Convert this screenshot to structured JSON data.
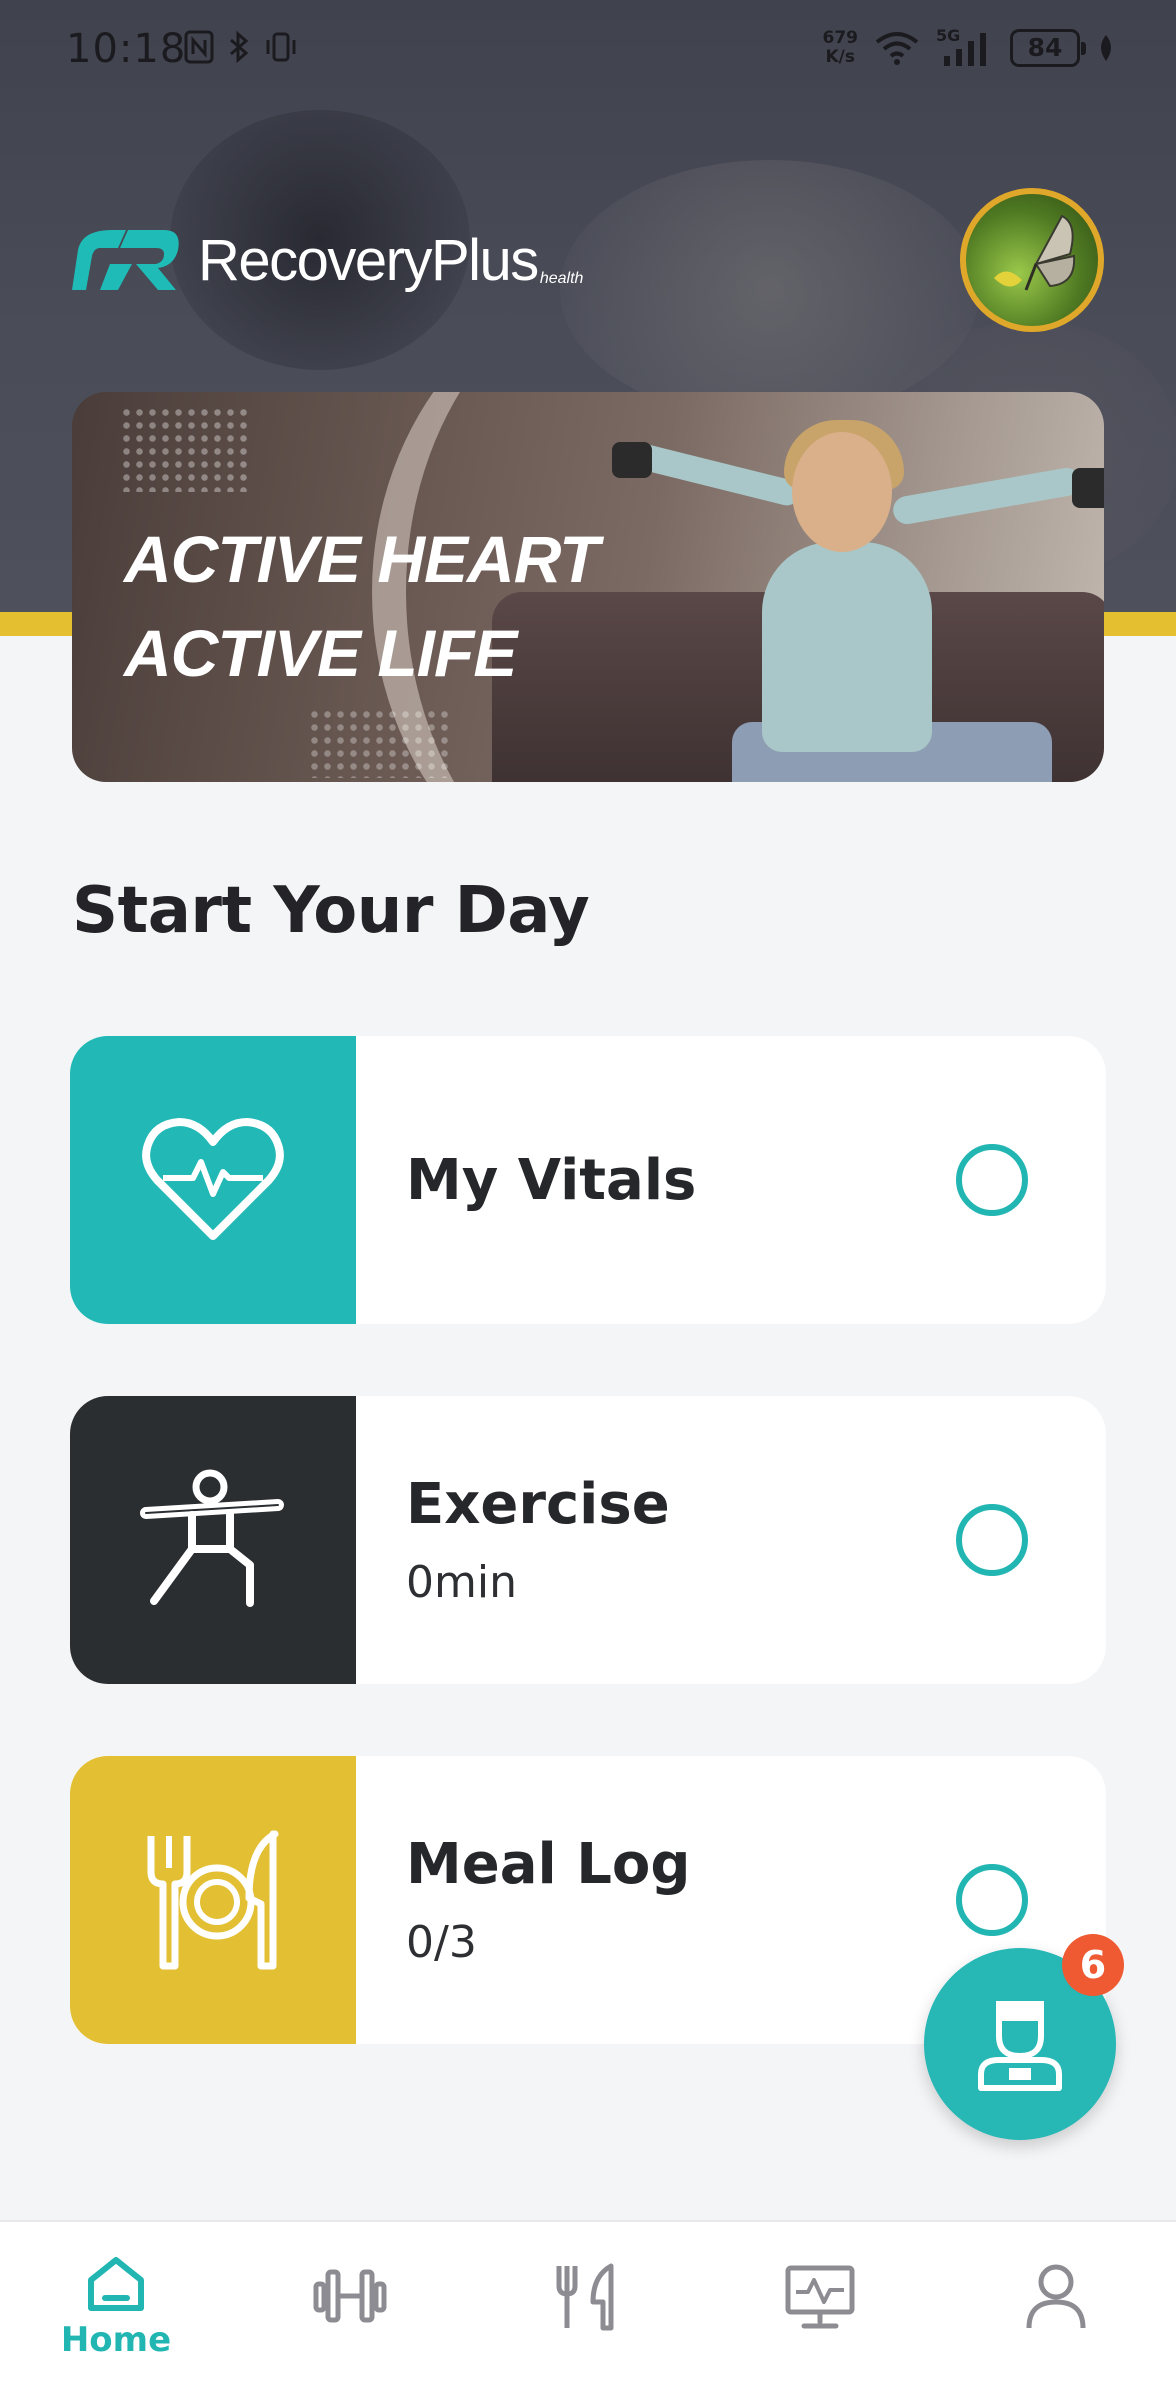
{
  "status_bar": {
    "time": "10:18",
    "net_speed_value": "679",
    "net_speed_unit": "K/s",
    "network": "5G",
    "battery": "84"
  },
  "header": {
    "brand_name": "RecoveryPlus",
    "brand_suffix": "health",
    "avatar_icon": "butterfly-avatar"
  },
  "banner": {
    "line1": "ACTIVE HEART",
    "line2": "ACTIVE LIFE"
  },
  "main": {
    "section_title": "Start Your Day",
    "cards": [
      {
        "title": "My Vitals",
        "subtitle": "",
        "icon": "heart-pulse-icon",
        "color": "#22b8b6"
      },
      {
        "title": "Exercise",
        "subtitle": "0min",
        "icon": "exercise-pose-icon",
        "color": "#2b2e31"
      },
      {
        "title": "Meal Log",
        "subtitle": "0/3",
        "icon": "plate-cutlery-icon",
        "color": "#e3bf33"
      }
    ]
  },
  "fab": {
    "icon": "doctor-icon",
    "badge": "6",
    "color": "#27b8b5",
    "badge_color": "#ef5a33"
  },
  "bottom_nav": {
    "items": [
      {
        "label": "Home",
        "icon": "home-icon",
        "active": true
      },
      {
        "label": "",
        "icon": "dumbbell-icon",
        "active": false
      },
      {
        "label": "",
        "icon": "fork-knife-icon",
        "active": false
      },
      {
        "label": "",
        "icon": "monitor-pulse-icon",
        "active": false
      },
      {
        "label": "",
        "icon": "profile-icon",
        "active": false
      }
    ],
    "active_color": "#22b6b3",
    "inactive_color": "#8c8c92"
  }
}
